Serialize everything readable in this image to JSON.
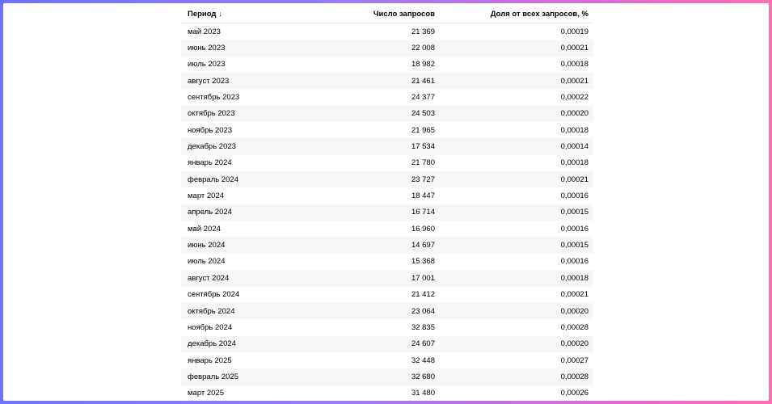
{
  "table": {
    "headers": {
      "period": "Период",
      "count": "Число запросов",
      "share": "Доля от всех запросов, %"
    },
    "sort_icon": "arrow-down-icon",
    "sort_glyph": "↓",
    "rows": [
      {
        "period": "май 2023",
        "count": "21 369",
        "share": "0,00019"
      },
      {
        "period": "июнь 2023",
        "count": "22 008",
        "share": "0,00021"
      },
      {
        "period": "июль 2023",
        "count": "18 982",
        "share": "0,00018"
      },
      {
        "period": "август 2023",
        "count": "21 461",
        "share": "0,00021"
      },
      {
        "period": "сентябрь 2023",
        "count": "24 377",
        "share": "0,00022"
      },
      {
        "period": "октябрь 2023",
        "count": "24 503",
        "share": "0,00020"
      },
      {
        "period": "ноябрь 2023",
        "count": "21 965",
        "share": "0,00018"
      },
      {
        "period": "декабрь 2023",
        "count": "17 534",
        "share": "0,00014"
      },
      {
        "period": "январь 2024",
        "count": "21 780",
        "share": "0,00018"
      },
      {
        "period": "февраль 2024",
        "count": "23 727",
        "share": "0,00021"
      },
      {
        "period": "март 2024",
        "count": "18 447",
        "share": "0,00016"
      },
      {
        "period": "апрель 2024",
        "count": "16 714",
        "share": "0,00015"
      },
      {
        "period": "май 2024",
        "count": "16 960",
        "share": "0,00016"
      },
      {
        "period": "июнь 2024",
        "count": "14 697",
        "share": "0,00015"
      },
      {
        "period": "июль 2024",
        "count": "15 368",
        "share": "0,00016"
      },
      {
        "period": "август 2024",
        "count": "17 001",
        "share": "0,00018"
      },
      {
        "period": "сентябрь 2024",
        "count": "21 412",
        "share": "0,00021"
      },
      {
        "period": "октябрь 2024",
        "count": "23 064",
        "share": "0,00020"
      },
      {
        "period": "ноябрь 2024",
        "count": "32 835",
        "share": "0,00028"
      },
      {
        "period": "декабрь 2024",
        "count": "24 607",
        "share": "0,00020"
      },
      {
        "period": "январь 2025",
        "count": "32 448",
        "share": "0,00027"
      },
      {
        "period": "февраль 2025",
        "count": "32 680",
        "share": "0,00028"
      },
      {
        "period": "март 2025",
        "count": "31 480",
        "share": "0,00026"
      }
    ]
  }
}
